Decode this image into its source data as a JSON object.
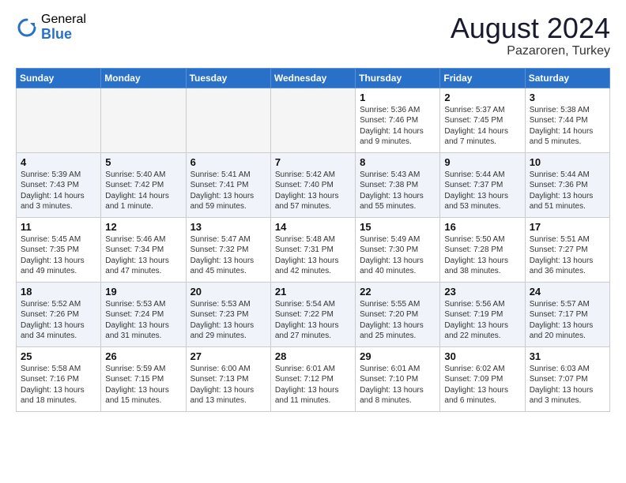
{
  "header": {
    "logo_general": "General",
    "logo_blue": "Blue",
    "main_title": "August 2024",
    "subtitle": "Pazaroren, Turkey"
  },
  "weekdays": [
    "Sunday",
    "Monday",
    "Tuesday",
    "Wednesday",
    "Thursday",
    "Friday",
    "Saturday"
  ],
  "rows": [
    [
      {
        "day": "",
        "info": ""
      },
      {
        "day": "",
        "info": ""
      },
      {
        "day": "",
        "info": ""
      },
      {
        "day": "",
        "info": ""
      },
      {
        "day": "1",
        "info": "Sunrise: 5:36 AM\nSunset: 7:46 PM\nDaylight: 14 hours\nand 9 minutes."
      },
      {
        "day": "2",
        "info": "Sunrise: 5:37 AM\nSunset: 7:45 PM\nDaylight: 14 hours\nand 7 minutes."
      },
      {
        "day": "3",
        "info": "Sunrise: 5:38 AM\nSunset: 7:44 PM\nDaylight: 14 hours\nand 5 minutes."
      }
    ],
    [
      {
        "day": "4",
        "info": "Sunrise: 5:39 AM\nSunset: 7:43 PM\nDaylight: 14 hours\nand 3 minutes."
      },
      {
        "day": "5",
        "info": "Sunrise: 5:40 AM\nSunset: 7:42 PM\nDaylight: 14 hours\nand 1 minute."
      },
      {
        "day": "6",
        "info": "Sunrise: 5:41 AM\nSunset: 7:41 PM\nDaylight: 13 hours\nand 59 minutes."
      },
      {
        "day": "7",
        "info": "Sunrise: 5:42 AM\nSunset: 7:40 PM\nDaylight: 13 hours\nand 57 minutes."
      },
      {
        "day": "8",
        "info": "Sunrise: 5:43 AM\nSunset: 7:38 PM\nDaylight: 13 hours\nand 55 minutes."
      },
      {
        "day": "9",
        "info": "Sunrise: 5:44 AM\nSunset: 7:37 PM\nDaylight: 13 hours\nand 53 minutes."
      },
      {
        "day": "10",
        "info": "Sunrise: 5:44 AM\nSunset: 7:36 PM\nDaylight: 13 hours\nand 51 minutes."
      }
    ],
    [
      {
        "day": "11",
        "info": "Sunrise: 5:45 AM\nSunset: 7:35 PM\nDaylight: 13 hours\nand 49 minutes."
      },
      {
        "day": "12",
        "info": "Sunrise: 5:46 AM\nSunset: 7:34 PM\nDaylight: 13 hours\nand 47 minutes."
      },
      {
        "day": "13",
        "info": "Sunrise: 5:47 AM\nSunset: 7:32 PM\nDaylight: 13 hours\nand 45 minutes."
      },
      {
        "day": "14",
        "info": "Sunrise: 5:48 AM\nSunset: 7:31 PM\nDaylight: 13 hours\nand 42 minutes."
      },
      {
        "day": "15",
        "info": "Sunrise: 5:49 AM\nSunset: 7:30 PM\nDaylight: 13 hours\nand 40 minutes."
      },
      {
        "day": "16",
        "info": "Sunrise: 5:50 AM\nSunset: 7:28 PM\nDaylight: 13 hours\nand 38 minutes."
      },
      {
        "day": "17",
        "info": "Sunrise: 5:51 AM\nSunset: 7:27 PM\nDaylight: 13 hours\nand 36 minutes."
      }
    ],
    [
      {
        "day": "18",
        "info": "Sunrise: 5:52 AM\nSunset: 7:26 PM\nDaylight: 13 hours\nand 34 minutes."
      },
      {
        "day": "19",
        "info": "Sunrise: 5:53 AM\nSunset: 7:24 PM\nDaylight: 13 hours\nand 31 minutes."
      },
      {
        "day": "20",
        "info": "Sunrise: 5:53 AM\nSunset: 7:23 PM\nDaylight: 13 hours\nand 29 minutes."
      },
      {
        "day": "21",
        "info": "Sunrise: 5:54 AM\nSunset: 7:22 PM\nDaylight: 13 hours\nand 27 minutes."
      },
      {
        "day": "22",
        "info": "Sunrise: 5:55 AM\nSunset: 7:20 PM\nDaylight: 13 hours\nand 25 minutes."
      },
      {
        "day": "23",
        "info": "Sunrise: 5:56 AM\nSunset: 7:19 PM\nDaylight: 13 hours\nand 22 minutes."
      },
      {
        "day": "24",
        "info": "Sunrise: 5:57 AM\nSunset: 7:17 PM\nDaylight: 13 hours\nand 20 minutes."
      }
    ],
    [
      {
        "day": "25",
        "info": "Sunrise: 5:58 AM\nSunset: 7:16 PM\nDaylight: 13 hours\nand 18 minutes."
      },
      {
        "day": "26",
        "info": "Sunrise: 5:59 AM\nSunset: 7:15 PM\nDaylight: 13 hours\nand 15 minutes."
      },
      {
        "day": "27",
        "info": "Sunrise: 6:00 AM\nSunset: 7:13 PM\nDaylight: 13 hours\nand 13 minutes."
      },
      {
        "day": "28",
        "info": "Sunrise: 6:01 AM\nSunset: 7:12 PM\nDaylight: 13 hours\nand 11 minutes."
      },
      {
        "day": "29",
        "info": "Sunrise: 6:01 AM\nSunset: 7:10 PM\nDaylight: 13 hours\nand 8 minutes."
      },
      {
        "day": "30",
        "info": "Sunrise: 6:02 AM\nSunset: 7:09 PM\nDaylight: 13 hours\nand 6 minutes."
      },
      {
        "day": "31",
        "info": "Sunrise: 6:03 AM\nSunset: 7:07 PM\nDaylight: 13 hours\nand 3 minutes."
      }
    ]
  ]
}
